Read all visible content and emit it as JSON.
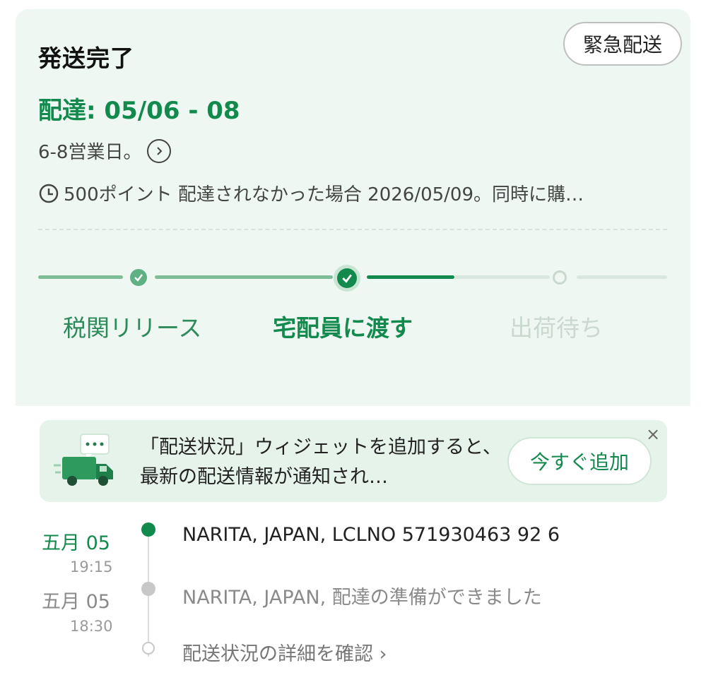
{
  "shipment": {
    "status_title": "発送完了",
    "express_button": "緊急配送",
    "delivery_window": "配達: 05/06 - 08",
    "business_days": "6-8営業日。",
    "guarantee_text": "500ポイント 配達されなかった場合 2026/05/09。同時に購…"
  },
  "progress": {
    "steps": [
      {
        "label": "税関リリース",
        "state": "done"
      },
      {
        "label": "宅配員に渡す",
        "state": "current"
      },
      {
        "label": "出荷待ち",
        "state": "pending"
      }
    ]
  },
  "widget_banner": {
    "text": "「配送状況」ウィジェットを追加すると、最新の配送情報が通知され…",
    "button": "今すぐ追加",
    "close": "×"
  },
  "timeline": {
    "events": [
      {
        "date": "五月 05",
        "time": "19:15",
        "text": "NARITA, JAPAN, LCLNO 571930463 92 6",
        "active": true
      },
      {
        "date": "五月 05",
        "time": "18:30",
        "text": "NARITA, JAPAN, 配達の準備ができました",
        "active": false
      }
    ],
    "detail_link": "配送状況の詳細を確認 ›"
  },
  "colors": {
    "accent": "#138a4d",
    "panel_bg": "#eef7f1",
    "muted": "#c9d9cf"
  },
  "icons": [
    "clock-icon",
    "chevron-right-icon",
    "check-icon",
    "truck-icon",
    "chat-bubble-icon",
    "close-icon"
  ]
}
